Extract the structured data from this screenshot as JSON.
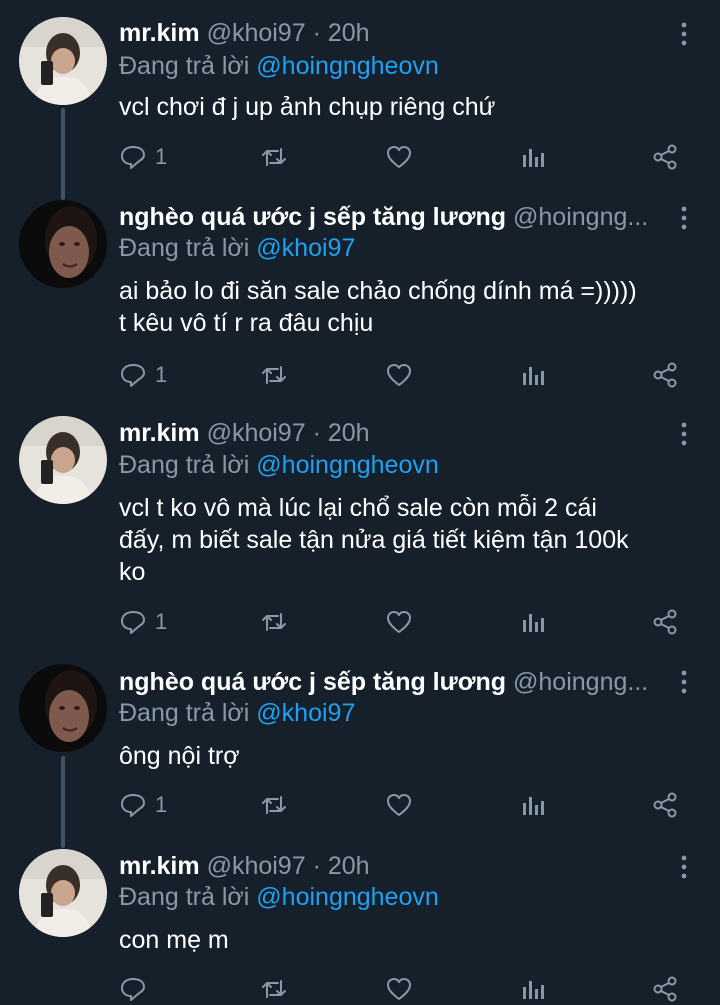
{
  "labels": {
    "replying_prefix": "Đang trả lời",
    "separator": "·"
  },
  "colors": {
    "background": "#15202b",
    "text": "#ffffff",
    "muted": "#8899a6",
    "mention": "#1da1f2",
    "thread_line": "#3d5466"
  },
  "icons": {
    "reply": "reply-icon",
    "retweet": "retweet-icon",
    "like": "like-icon",
    "analytics": "analytics-icon",
    "share": "share-icon",
    "more": "more-icon"
  },
  "tweets": [
    {
      "name": "mr.kim",
      "handle": "@khoi97",
      "time": "20h",
      "replying_to": "@hoingngheovn",
      "lines": [
        "vcl chơi đ j up ảnh chụp riêng chứ"
      ],
      "reply_count": "1"
    },
    {
      "name": "nghèo quá ước j sếp tăng lương",
      "handle": "@hoingng...",
      "time": "",
      "replying_to": "@khoi97",
      "lines": [
        "ai bảo lo đi săn sale chảo chống dính má =)))))",
        "t kêu vô tí r ra đâu chịu"
      ],
      "reply_count": "1"
    },
    {
      "name": "mr.kim",
      "handle": "@khoi97",
      "time": "20h",
      "replying_to": "@hoingngheovn",
      "lines": [
        "vcl t ko vô mà lúc lại chổ sale còn mỗi 2 cái",
        "đấy, m biết sale tận nửa giá tiết kiệm tận 100k",
        "ko"
      ],
      "reply_count": "1"
    },
    {
      "name": "nghèo quá ước j sếp tăng lương",
      "handle": "@hoingng...",
      "time": "",
      "replying_to": "@khoi97",
      "lines": [
        "ông nội trợ"
      ],
      "reply_count": "1"
    },
    {
      "name": "mr.kim",
      "handle": "@khoi97",
      "time": "20h",
      "replying_to": "@hoingngheovn",
      "lines": [
        "con mẹ m"
      ],
      "reply_count": ""
    }
  ]
}
